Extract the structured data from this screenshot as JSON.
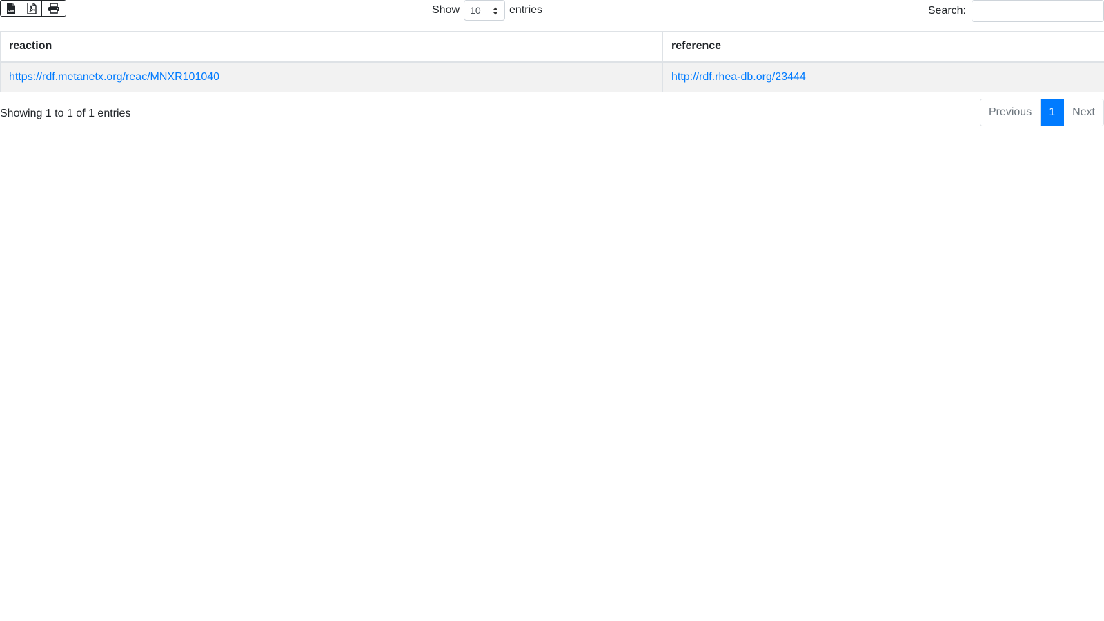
{
  "toolbar": {
    "buttons": [
      {
        "icon": "csv-file-icon"
      },
      {
        "icon": "pdf-file-icon"
      },
      {
        "icon": "print-icon"
      }
    ]
  },
  "length": {
    "show_label": "Show",
    "selected": "10",
    "entries_label": "entries"
  },
  "search": {
    "label": "Search:",
    "value": ""
  },
  "table": {
    "headers": [
      "reaction",
      "reference"
    ],
    "rows": [
      [
        "https://rdf.metanetx.org/reac/MNXR101040",
        "http://rdf.rhea-db.org/23444"
      ]
    ]
  },
  "info": "Showing 1 to 1 of 1 entries",
  "pagination": {
    "previous": "Previous",
    "current": "1",
    "next": "Next"
  },
  "colors": {
    "link": "#007bff",
    "active_page": "#007bff",
    "row_stripe": "#f2f2f2"
  }
}
